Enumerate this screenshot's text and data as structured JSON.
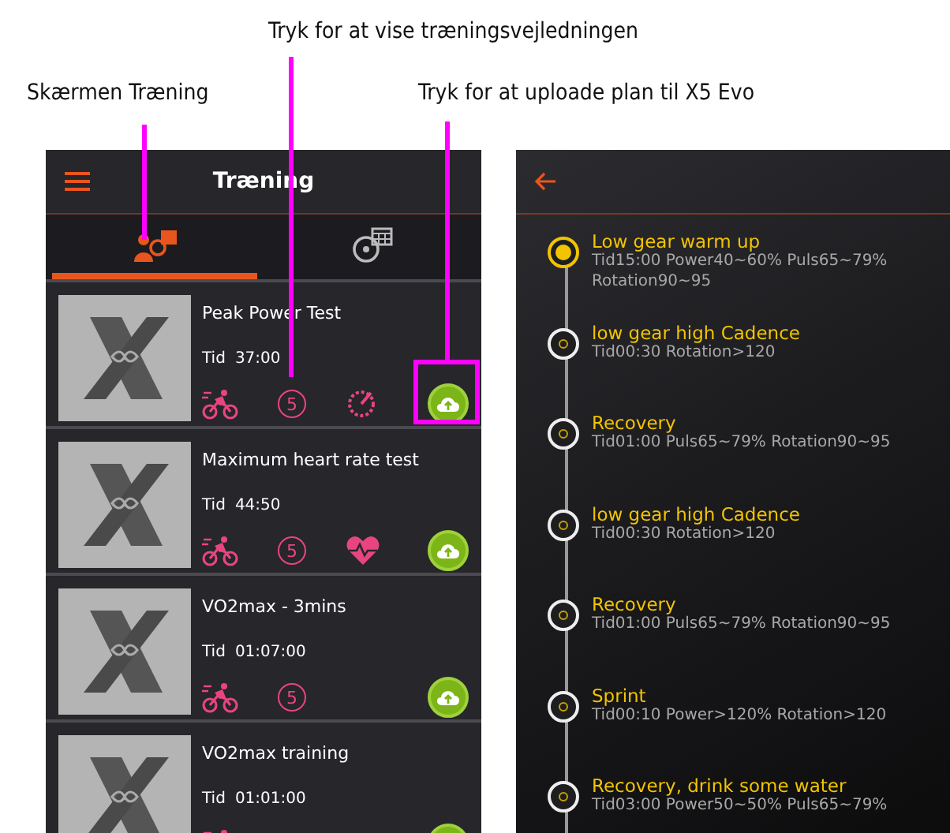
{
  "callouts": [
    {
      "text": "Tryk for at vise træningsvejledningen",
      "kind": "top"
    },
    {
      "text": "Skærmen Træning",
      "kind": "left"
    },
    {
      "text": "Tryk for at uploade plan til X5 Evo",
      "kind": "right"
    }
  ],
  "list_screen": {
    "title": "Træning",
    "tabs": [
      {
        "kind": "person",
        "selected": true
      },
      {
        "kind": "calendar",
        "selected": false
      }
    ],
    "workouts": [
      {
        "name": "Peak Power Test",
        "time_label": "Tid",
        "time": "37:00",
        "level_badge": "5",
        "kind": "gauge"
      },
      {
        "name": "Maximum heart rate test",
        "time_label": "Tid",
        "time": "44:50",
        "level_badge": "5",
        "kind": "heart"
      },
      {
        "name": "VO2max  - 3mins",
        "time_label": "Tid",
        "time": "01:07:00",
        "level_badge": "5",
        "kind": "plain"
      },
      {
        "name": "VO2max training",
        "time_label": "Tid",
        "time": "01:01:00",
        "kind": "plain"
      }
    ]
  },
  "guide_screen": {
    "steps": [
      {
        "title": "Low gear warm up",
        "detail": "Tid15:00 Power40~60% Puls65~79% Rotation90~95",
        "selected": true
      },
      {
        "title": "low gear high Cadence",
        "detail": "Tid00:30   Rotation>120",
        "selected": false
      },
      {
        "title": "Recovery",
        "detail": "Tid01:00  Puls65~79% Rotation90~95",
        "selected": false
      },
      {
        "title": "low gear high Cadence",
        "detail": "Tid00:30   Rotation>120",
        "selected": false
      },
      {
        "title": "Recovery",
        "detail": "Tid01:00  Puls65~79% Rotation90~95",
        "selected": false
      },
      {
        "title": "Sprint",
        "detail": "Tid00:10 Power>120%  Rotation>120",
        "selected": false
      },
      {
        "title": "Recovery, drink some water",
        "detail": "Tid03:00 Power50~50% Puls65~79%",
        "selected": false
      }
    ]
  }
}
